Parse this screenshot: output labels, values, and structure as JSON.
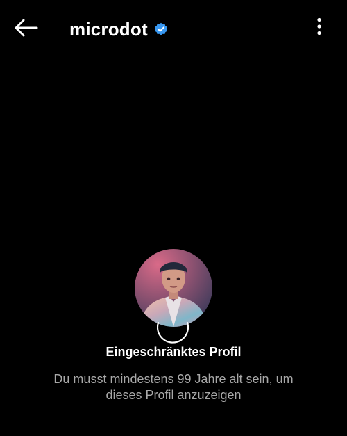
{
  "header": {
    "username": "microdot",
    "verified": true,
    "back_icon": "arrow-left-icon",
    "menu_icon": "more-vertical-icon"
  },
  "restriction": {
    "title": "Eingeschränktes Profil",
    "message": "Du musst mindestens 99 Jahre alt sein, um dieses Profil anzuzeigen"
  },
  "colors": {
    "background": "#000000",
    "verified_badge": "#3897f0",
    "text_primary": "#ffffff",
    "text_secondary": "#a8a8a8"
  }
}
